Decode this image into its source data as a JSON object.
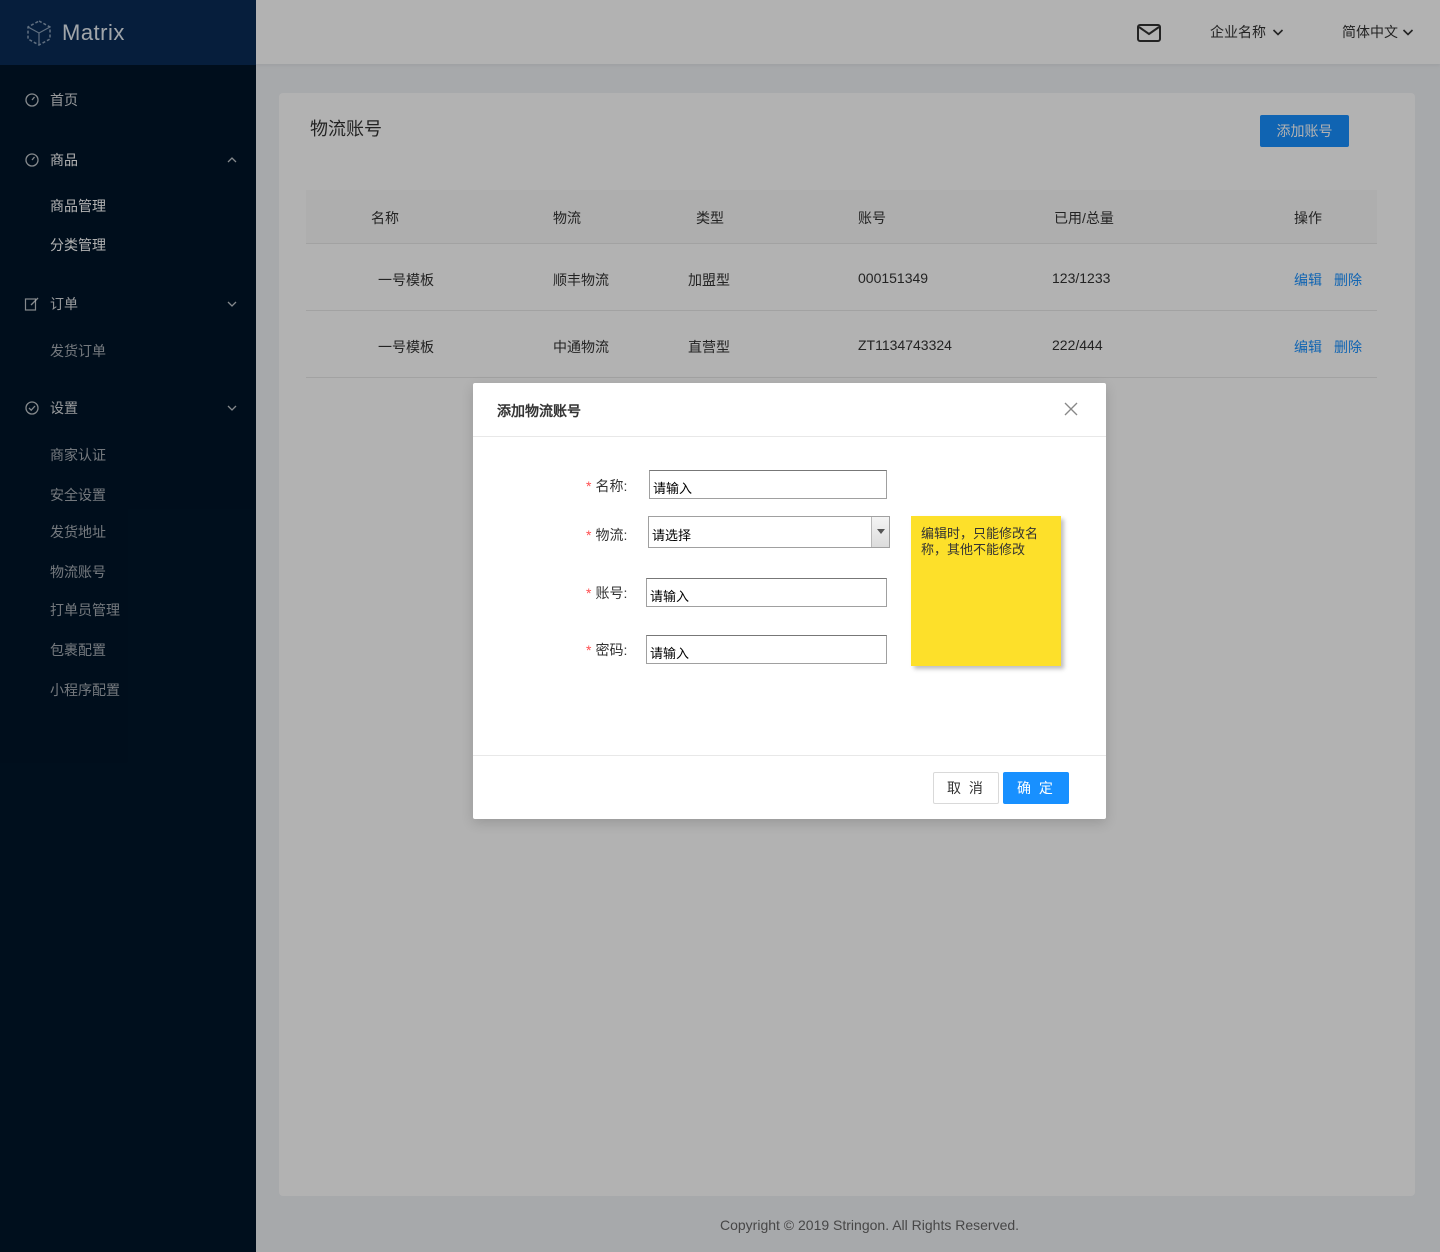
{
  "app": {
    "brand": "Matrix"
  },
  "header": {
    "company": "企业名称",
    "language": "简体中文"
  },
  "sidebar": {
    "home": "首页",
    "goods": {
      "label": "商品",
      "items": [
        "商品管理",
        "分类管理"
      ]
    },
    "orders": {
      "label": "订单",
      "items": [
        "发货订单"
      ]
    },
    "settings": {
      "label": "设置",
      "items": [
        "商家认证",
        "安全设置",
        "发货地址",
        "物流账号",
        "打单员管理",
        "包裹配置",
        "小程序配置"
      ]
    }
  },
  "page": {
    "title": "物流账号",
    "add_button": "添加账号"
  },
  "table": {
    "columns": [
      "名称",
      "物流",
      "类型",
      "账号",
      "已用/总量",
      "操作"
    ],
    "rows": [
      {
        "name": "一号模板",
        "carrier": "顺丰物流",
        "type": "加盟型",
        "account": "000151349",
        "usage": "123/1233",
        "edit": "编辑",
        "delete": "删除"
      },
      {
        "name": "一号模板",
        "carrier": "中通物流",
        "type": "直营型",
        "account": "ZT1134743324",
        "usage": "222/444",
        "edit": "编辑",
        "delete": "删除"
      }
    ]
  },
  "modal": {
    "title": "添加物流账号",
    "fields": {
      "name": {
        "label": "名称:",
        "value": "请输入"
      },
      "carrier": {
        "label": "物流:",
        "value": "请选择"
      },
      "account": {
        "label": "账号:",
        "value": "请输入"
      },
      "password": {
        "label": "密码:",
        "value": "请输入"
      }
    },
    "required_mark": "*",
    "note": "编辑时，只能修改名称，其他不能修改",
    "cancel": "取 消",
    "ok": "确 定"
  },
  "footer": {
    "copyright": "Copyright © 2019 Stringon. All Rights Reserved."
  },
  "colors": {
    "primary": "#1890ff",
    "sidebar": "#001529",
    "note": "#fde02a"
  }
}
